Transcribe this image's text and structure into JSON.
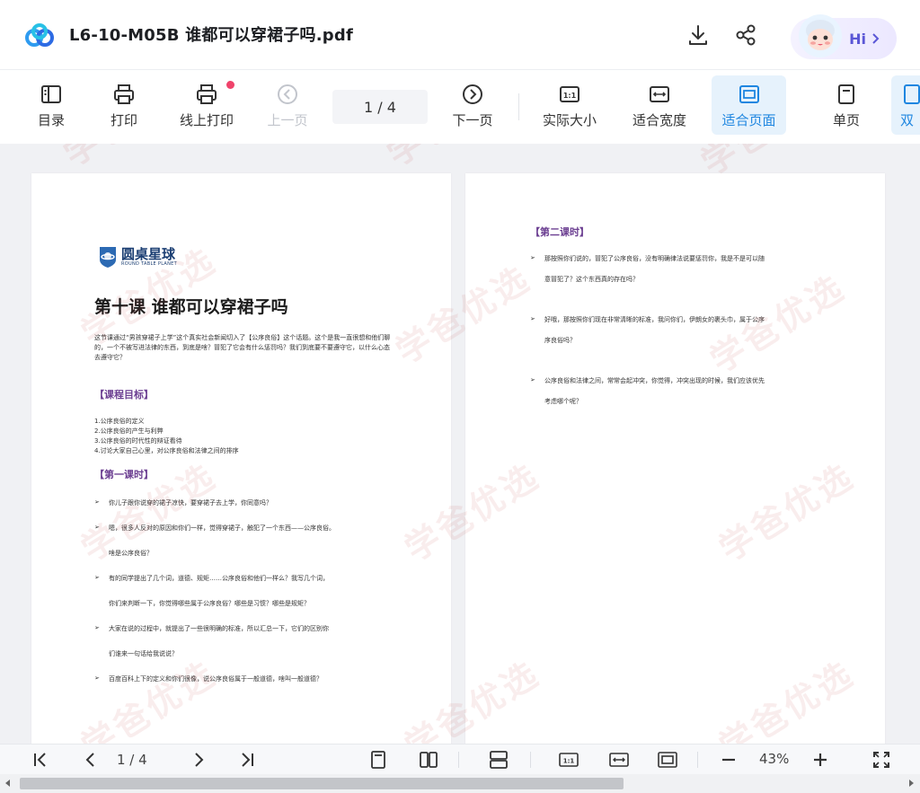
{
  "header": {
    "file_title": "L6-10-M05B 谁都可以穿裙子吗.pdf",
    "icons": {
      "logo": "cloud-logo-icon",
      "download": "download-icon",
      "share": "share-icon",
      "avatar": "assistant-avatar-icon"
    },
    "hi_label": "Hi",
    "accent": "#1e86e0"
  },
  "toolbar": {
    "toc": "目录",
    "print": "打印",
    "online_print": "线上打印",
    "prev_page": "上一页",
    "page_indicator": "1  / 4",
    "next_page": "下一页",
    "actual_size": "实际大小",
    "fit_width": "适合宽度",
    "fit_page": "适合页面",
    "single_page": "单页",
    "double_page": "双"
  },
  "document": {
    "left_page": {
      "logo_cn": "圆桌星球",
      "logo_en": "ROUND TABLE PLANET",
      "title": "第十课 谁都可以穿裙子吗",
      "intro": "这节课通过“男孩穿裙子上学”这个真实社会新闻切入了【公序良俗】这个话题。这个是我一直很想和他们聊的，一个不被写进法律的东西，到底是啥？冒犯了它会有什么惩罚吗？我们到底要不要遵守它，以什么心态去遵守它？",
      "goals_heading": "【课程目标】",
      "goals": [
        "1.公序良俗的定义",
        "2.公序良俗的产生与利弊",
        "3.公序良俗的时代性的辩证看待",
        "4.讨论大家自己心里，对公序良俗和法律之间的排序"
      ],
      "lesson1_heading": "【第一课时】",
      "questions": [
        {
          "l1": "你儿子跟你说穿的裙子凉快，要穿裙子去上学，你同意吗？",
          "l2": ""
        },
        {
          "l1": "嗯，很多人反对的原因和你们一样，觉得穿裙子，触犯了一个东西——公序良俗。",
          "l2": "啥是公序良俗？"
        },
        {
          "l1": "有的同学提出了几个词，道德、规矩……公序良俗和他们一样么？我写几个词，",
          "l2": "你们来判断一下，你觉得哪些属于公序良俗？哪些是习惯？哪些是规矩？"
        },
        {
          "l1": "大家在说的过程中，就提出了一些很明确的标准，所以汇总一下，它们的区别你",
          "l2": "们谁来一句话给我说说？"
        },
        {
          "l1": "百度百科上下的定义和你们很像，说公序良俗属于一般道德，啥叫一般道德？",
          "l2": ""
        }
      ]
    },
    "right_page": {
      "lesson2_heading": "【第二课时】",
      "questions": [
        {
          "l1": "那按照你们说的，冒犯了公序良俗，没有明确律法说要惩罚你，我是不是可以随",
          "l2": "意冒犯了？这个东西真的存在吗？"
        },
        {
          "l1": "好哦，那按照你们现在非常清晰的标准，我问你们，伊朗女的裹头巾，属于公序",
          "l2": "序良俗吗？"
        },
        {
          "l1": "公序良俗和法律之间，常常会起冲突，你觉得，冲突出现的时候，我们应该优先",
          "l2": "考虑哪个呢？"
        }
      ]
    },
    "watermark": "学爸优选"
  },
  "bottombar": {
    "page_indicator": "1  / 4",
    "zoom": "43%",
    "icons": [
      "first-page-icon",
      "prev-page-icon",
      "next-page-icon",
      "last-page-icon",
      "single-page-icon",
      "double-page-icon",
      "continuous-scroll-icon",
      "actual-size-icon",
      "fit-width-icon",
      "fit-page-icon",
      "zoom-out-icon",
      "zoom-in-icon",
      "fullscreen-icon"
    ]
  }
}
